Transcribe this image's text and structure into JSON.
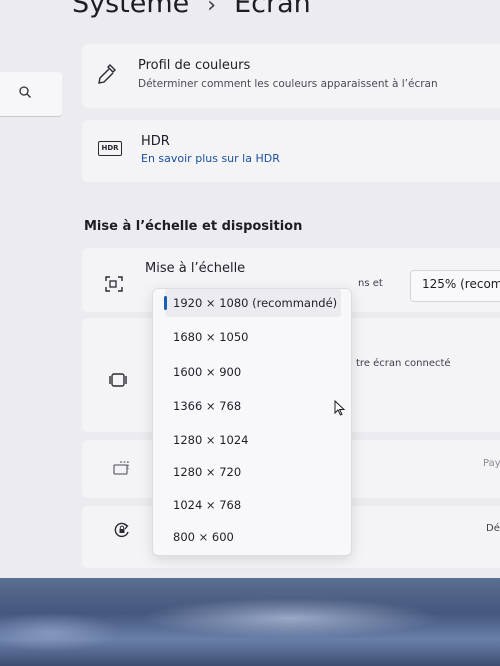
{
  "header": {
    "breadcrumb_parent": "Système",
    "separator": "›",
    "page_title": "Écran"
  },
  "search": {
    "icon": "search-icon"
  },
  "color_profile": {
    "icon": "dropper-icon",
    "title": "Profil de couleurs",
    "subtitle": "Déterminer comment les couleurs apparaissent à l’écran"
  },
  "hdr": {
    "icon": "hdr-icon",
    "icon_text": "HDR",
    "title": "HDR",
    "link": "En savoir plus sur la HDR"
  },
  "scale_section": {
    "title": "Mise à l’échelle et disposition",
    "scale_row": {
      "title": "Mise à l’échelle",
      "partial_text": "ns et",
      "value": "125% (recom"
    },
    "orientation_partial": "tre  écran connecté",
    "partial_right_1": "Pay",
    "partial_right_2": "Dé"
  },
  "resolution_dropdown": {
    "options": [
      "1920 × 1080 (recommandé)",
      "1680 × 1050",
      "1600 × 900",
      "1366 × 768",
      "1280 × 1024",
      "1280 × 720",
      "1024 × 768",
      "800 × 600"
    ],
    "selected": "1920 × 1080 (recommandé)"
  },
  "colors": {
    "accent": "#1a5fb4",
    "link": "#1a4f9c",
    "background": "#ecebef"
  }
}
